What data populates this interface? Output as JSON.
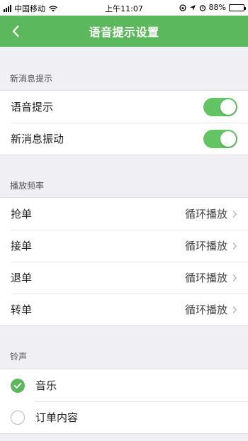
{
  "status_bar": {
    "carrier": "中国移动",
    "time": "上午11:07",
    "battery": "88%",
    "battery_level": 0.88
  },
  "nav": {
    "title": "语音提示设置",
    "back_icon": "chevron-left-icon"
  },
  "sections": {
    "new_message": {
      "header": "新消息提示",
      "voice_prompt": {
        "label": "语音提示",
        "enabled": true
      },
      "vibrate": {
        "label": "新消息振动",
        "enabled": true
      }
    },
    "frequency": {
      "header": "播放频率",
      "items": [
        {
          "label": "抢单",
          "value": "循环播放"
        },
        {
          "label": "接单",
          "value": "循环播放"
        },
        {
          "label": "退单",
          "value": "循环播放"
        },
        {
          "label": "转单",
          "value": "循环播放"
        }
      ]
    },
    "ringtone": {
      "header": "铃声",
      "options": [
        {
          "label": "音乐",
          "selected": true
        },
        {
          "label": "订单内容",
          "selected": false
        }
      ]
    }
  },
  "colors": {
    "accent": "#5cb85c",
    "toggle_on": "#62c462",
    "background": "#efeff4"
  }
}
